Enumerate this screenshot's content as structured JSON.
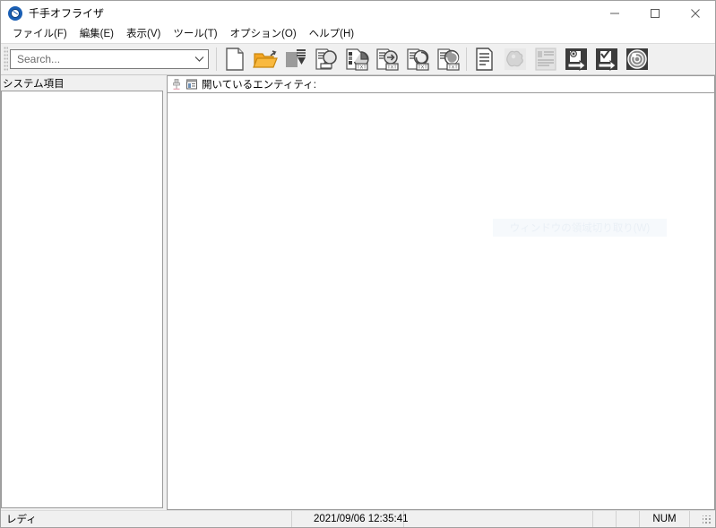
{
  "window": {
    "title": "千手オフライザ",
    "icon": "compass-icon",
    "controls": {
      "minimize": "minimize-icon",
      "maximize": "maximize-icon",
      "close": "close-icon"
    }
  },
  "menubar": {
    "items": [
      {
        "label": "ファイル(F)"
      },
      {
        "label": "編集(E)"
      },
      {
        "label": "表示(V)"
      },
      {
        "label": "ツール(T)"
      },
      {
        "label": "オプション(O)"
      },
      {
        "label": "ヘルプ(H)"
      }
    ]
  },
  "toolbar": {
    "search": {
      "value": "",
      "placeholder": "Search...",
      "dropdown_icon": "chevron-down-icon"
    },
    "buttons": [
      {
        "name": "new-document-button",
        "icon": "new-document-icon"
      },
      {
        "name": "open-folder-button",
        "icon": "open-folder-icon"
      },
      {
        "name": "save-download-button",
        "icon": "save-download-icon"
      },
      {
        "name": "entity-search-button",
        "icon": "document-search-icon"
      },
      {
        "name": "export-txt-button",
        "icon": "document-chart-txt-icon"
      },
      {
        "name": "import-txt-button",
        "icon": "document-arrow-txt-icon"
      },
      {
        "name": "convert-txt-button",
        "icon": "document-convert-txt-icon"
      },
      {
        "name": "inspect-txt-button",
        "icon": "document-inspect-txt-icon"
      },
      {
        "name": "report-page-button",
        "icon": "lined-page-icon"
      },
      {
        "name": "puzzle-button",
        "icon": "puzzle-piece-icon"
      },
      {
        "name": "list-view-button",
        "icon": "list-document-icon"
      },
      {
        "name": "config-export-button",
        "icon": "gear-export-icon"
      },
      {
        "name": "check-export-button",
        "icon": "check-export-icon"
      },
      {
        "name": "target-scan-button",
        "icon": "target-scan-icon"
      }
    ]
  },
  "panes": {
    "left": {
      "caption": "システム項目",
      "items": []
    },
    "right": {
      "caption": "開いているエンティティ:",
      "pin_icon": "pin-icon",
      "window_icon": "window-list-icon",
      "ghost_tooltip": "ウィンドウの領域切り取り(W)"
    }
  },
  "statusbar": {
    "ready": "レディ",
    "timestamp": "2021/09/06 12:35:41",
    "blank_1": "",
    "blank_2": "",
    "blank_3": "",
    "num": "NUM",
    "resize_grip": "resize-grip-icon"
  },
  "colors": {
    "accent_orange": "#f5a623",
    "icon_gray": "#9b9b9b",
    "toolbar_bg": "#f0f0f0",
    "border": "#9a9a9a",
    "title_icon_blue": "#1a5fb4"
  }
}
